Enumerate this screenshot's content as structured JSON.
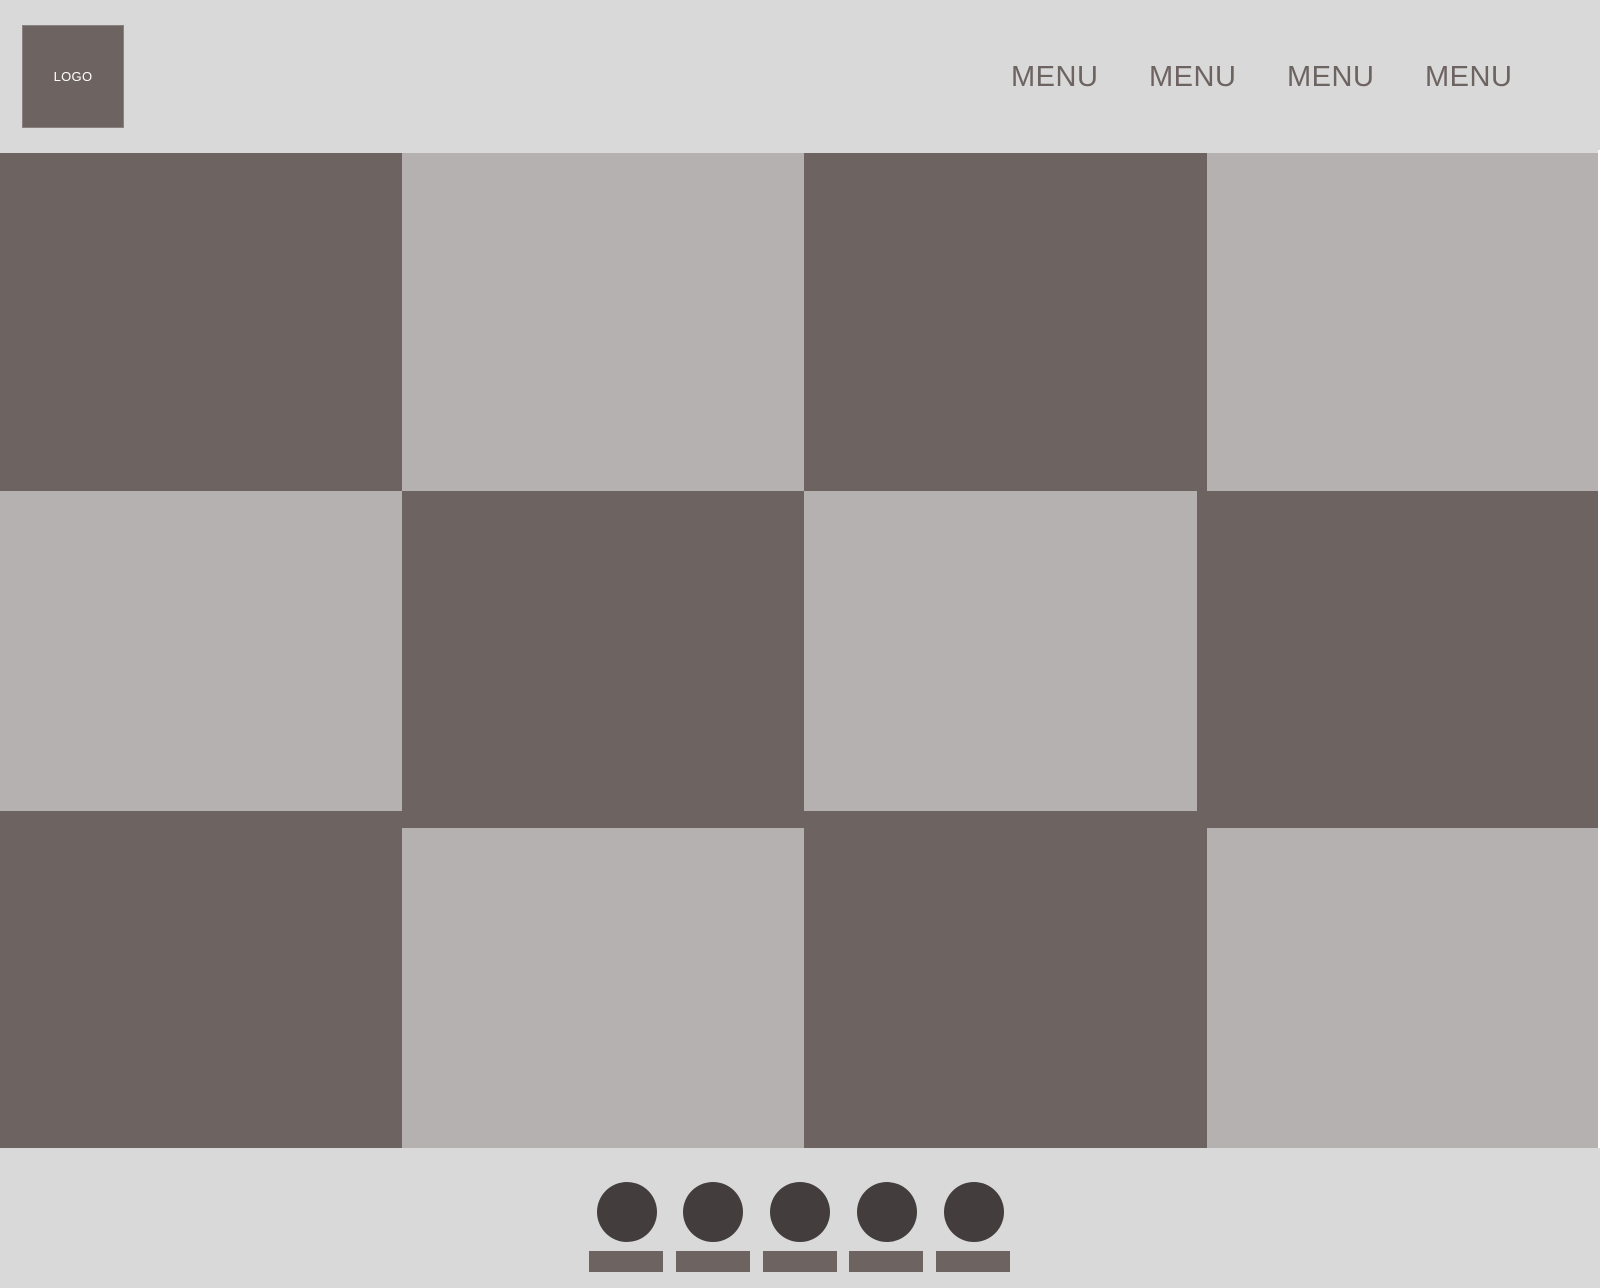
{
  "header": {
    "logo_label": "LOGO",
    "menu": [
      {
        "label": "MENU"
      },
      {
        "label": "MENU"
      },
      {
        "label": "MENU"
      },
      {
        "label": "MENU"
      }
    ]
  },
  "colors": {
    "header_bg": "#d9d9d9",
    "tile_dark": "#6d6462",
    "tile_light": "#b5b1b0",
    "dot": "#433e3d",
    "bar": "#6d6462"
  },
  "gallery": {
    "rows": 3,
    "columns": 4,
    "tile_count": 12
  },
  "footer": {
    "indicator_count": 5
  }
}
